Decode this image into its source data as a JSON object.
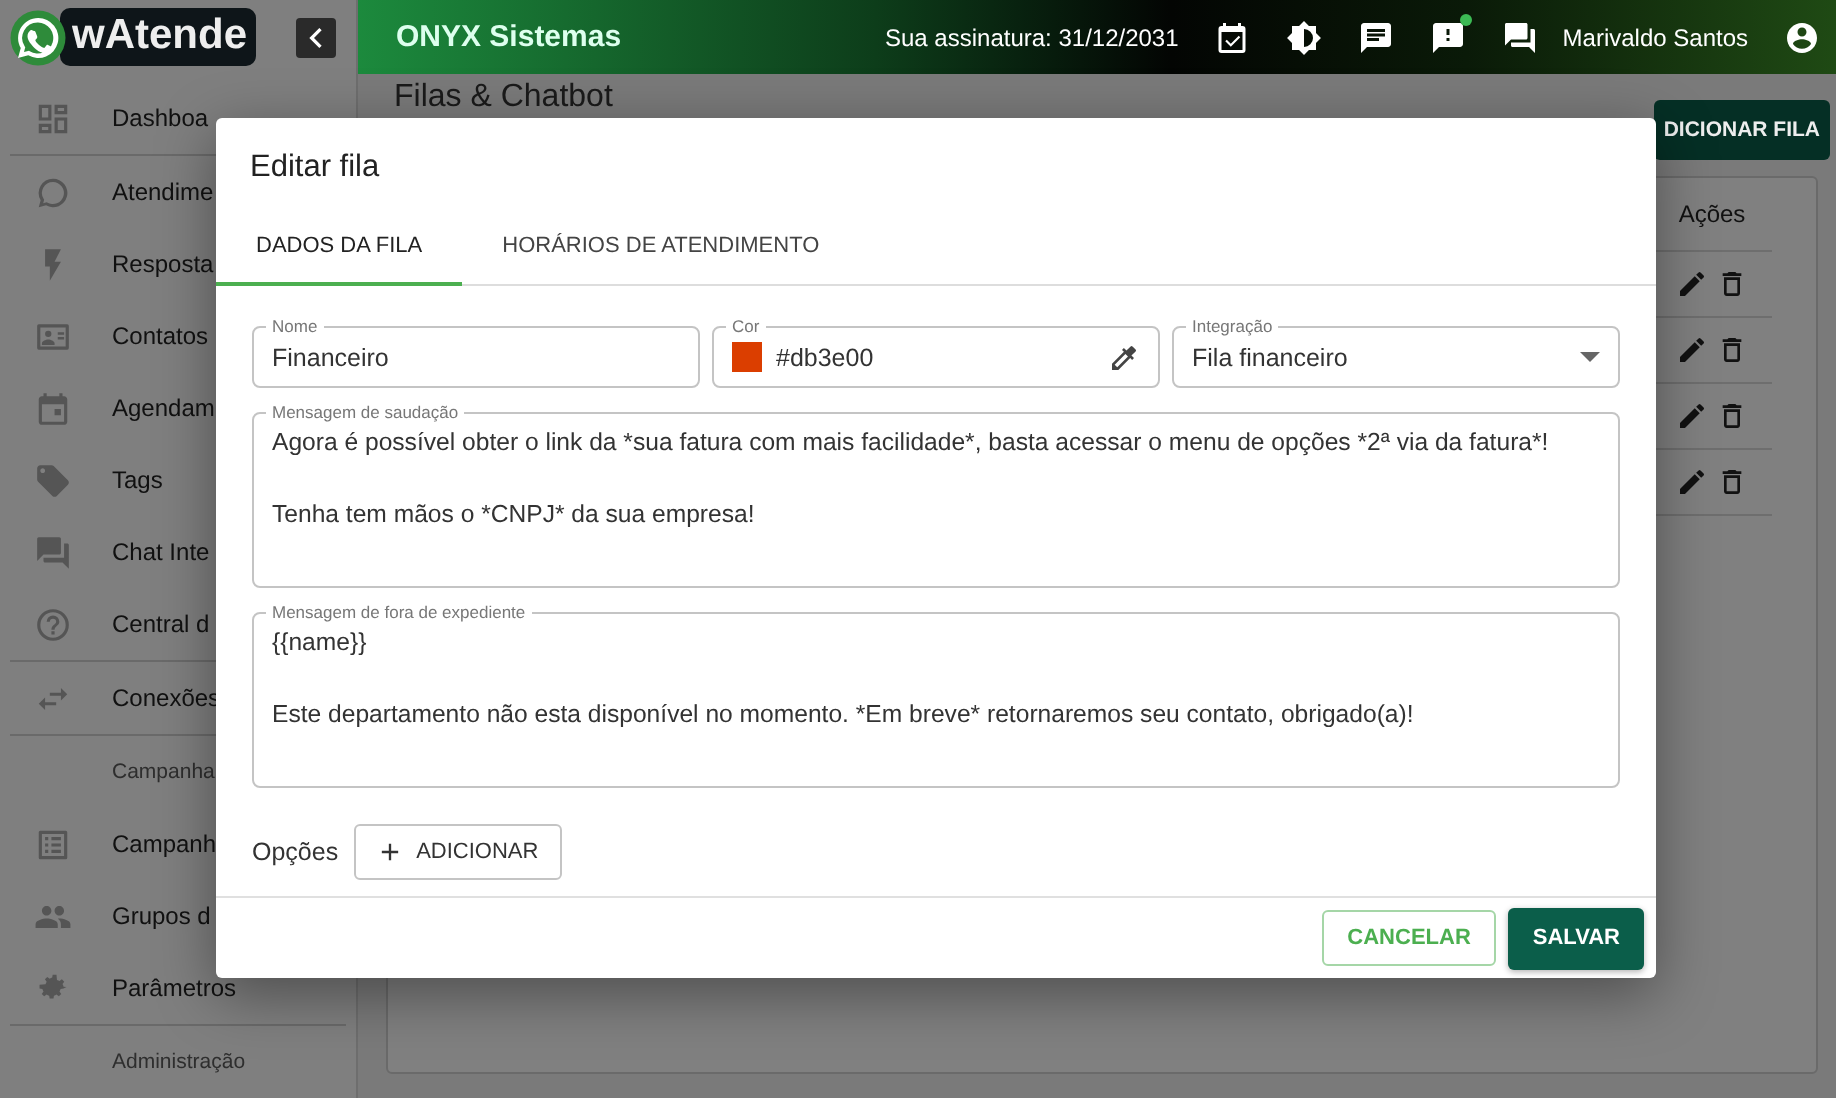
{
  "app": {
    "logo": "wAtende",
    "company": "ONYX Sistemas",
    "subscription": "Sua assinatura: 31/12/2031",
    "user": "Marivaldo Santos",
    "alerts_badge": true
  },
  "sidebar": {
    "items": [
      {
        "kind": "item",
        "label": "Dashboa"
      },
      {
        "kind": "divider"
      },
      {
        "kind": "item",
        "label": "Atendime"
      },
      {
        "kind": "item",
        "label": "Resposta"
      },
      {
        "kind": "item",
        "label": "Contatos"
      },
      {
        "kind": "item",
        "label": "Agendam"
      },
      {
        "kind": "item",
        "label": "Tags"
      },
      {
        "kind": "item",
        "label": "Chat Inte"
      },
      {
        "kind": "item",
        "label": "Central d"
      },
      {
        "kind": "divider"
      },
      {
        "kind": "item",
        "label": "Conexões"
      },
      {
        "kind": "divider"
      },
      {
        "kind": "header",
        "label": "Campanha"
      },
      {
        "kind": "item",
        "label": "Campanh"
      },
      {
        "kind": "item",
        "label": "Grupos d"
      },
      {
        "kind": "item",
        "label": "Parâmetros"
      },
      {
        "kind": "divider"
      },
      {
        "kind": "header",
        "label": "Administração"
      }
    ]
  },
  "page": {
    "title": "Filas & Chatbot",
    "add_button": "DICIONAR FILA",
    "actions_column": "Ações",
    "rows": [
      {
        "kind": "actions"
      },
      {
        "kind": "actions"
      },
      {
        "kind": "actions"
      },
      {
        "kind": "actions"
      }
    ]
  },
  "dialog": {
    "title": "Editar fila",
    "tabs": [
      {
        "label": "DADOS DA FILA",
        "selected": true
      },
      {
        "label": "HORÁRIOS DE ATENDIMENTO",
        "selected": false
      }
    ],
    "name": {
      "label": "Nome",
      "value": "Financeiro"
    },
    "color": {
      "label": "Cor",
      "value": "#db3e00",
      "color": "#db3e00"
    },
    "integration": {
      "label": "Integração",
      "value": "Fila financeiro"
    },
    "greeting": {
      "label": "Mensagem de saudação",
      "value": "Agora é possível obter o link da *sua fatura com mais facilidade*, basta acessar o menu de opções *2ª via da fatura*!\n\nTenha tem mãos o *CNPJ* da sua empresa!"
    },
    "off_hours": {
      "label": "Mensagem de fora de expediente",
      "value": "{{name}}\n\nEste departamento não esta disponível no momento. *Em breve* retornaremos seu contato, obrigado(a)!"
    },
    "options_label": "Opções",
    "add_option": "ADICIONAR",
    "buttons": [
      {
        "kind": "secondary",
        "label": "CANCELAR"
      },
      {
        "kind": "primary",
        "label": "SALVAR"
      }
    ]
  }
}
